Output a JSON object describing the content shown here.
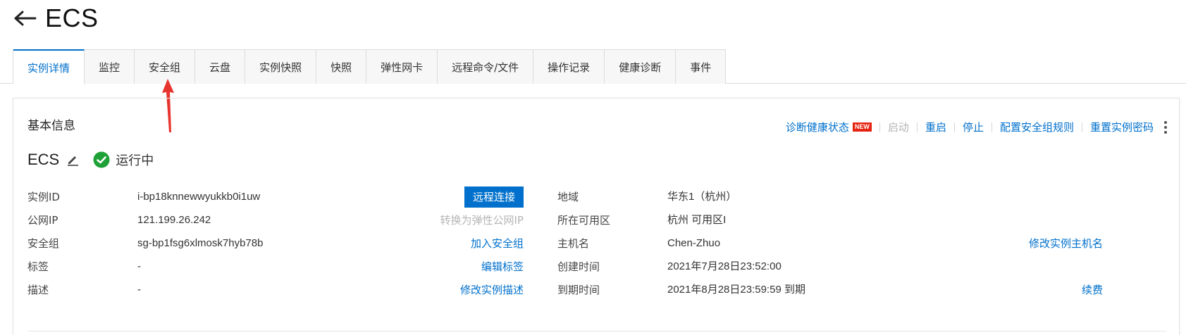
{
  "header": {
    "back_icon": "arrow-left-icon",
    "title": "ECS"
  },
  "tabs": [
    {
      "label": "实例详情",
      "active": true
    },
    {
      "label": "监控"
    },
    {
      "label": "安全组"
    },
    {
      "label": "云盘"
    },
    {
      "label": "实例快照"
    },
    {
      "label": "快照"
    },
    {
      "label": "弹性网卡"
    },
    {
      "label": "远程命令/文件"
    },
    {
      "label": "操作记录"
    },
    {
      "label": "健康诊断"
    },
    {
      "label": "事件"
    }
  ],
  "annotation": {
    "color": "#e8342e"
  },
  "basic_info": {
    "section_title": "基本信息",
    "actions": {
      "diagnose": "诊断健康状态",
      "new_badge": "NEW",
      "start": "启动",
      "restart": "重启",
      "stop": "停止",
      "config_sg_rules": "配置安全组规则",
      "reset_password": "重置实例密码"
    },
    "instance_name": "ECS",
    "status": "运行中",
    "status_color": "#1ea136",
    "left": [
      {
        "label": "实例ID",
        "value": "i-bp18knnewwyukkb0i1uw",
        "action": "远程连接"
      },
      {
        "label": "公网IP",
        "value": "121.199.26.242",
        "action": "转换为弹性公网IP"
      },
      {
        "label": "安全组",
        "value": "sg-bp1fsg6xlmosk7hyb78b",
        "action": "加入安全组"
      },
      {
        "label": "标签",
        "value": "-",
        "action": "编辑标签"
      },
      {
        "label": "描述",
        "value": "-",
        "action": "修改实例描述"
      }
    ],
    "right": [
      {
        "label": "地域",
        "value": "华东1（杭州）",
        "action": ""
      },
      {
        "label": "所在可用区",
        "value": "杭州 可用区I",
        "action": ""
      },
      {
        "label": "主机名",
        "value": "Chen-Zhuo",
        "action": "修改实例主机名"
      },
      {
        "label": "创建时间",
        "value": "2021年7月28日23:52:00",
        "action": ""
      },
      {
        "label": "到期时间",
        "value": "2021年8月28日23:59:59 到期",
        "action": "续费"
      }
    ]
  },
  "colors": {
    "accent": "#0070cc",
    "disabled": "#b5b5b5"
  }
}
